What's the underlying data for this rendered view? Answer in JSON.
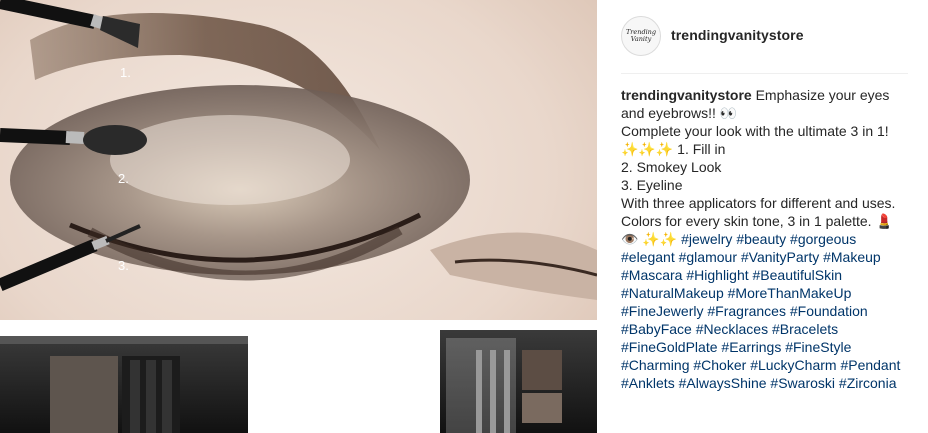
{
  "post": {
    "media": {
      "step_labels": [
        "1.",
        "2.",
        "3."
      ]
    },
    "header": {
      "avatar_text": [
        "Trending",
        "Vanity"
      ],
      "username": "trendingvanitystore"
    },
    "caption": {
      "author": "trendingvanitystore",
      "intro": "Emphasize your eyes and eyebrows!! 👀",
      "line2": "Complete your look with the ultimate 3 in 1!",
      "line3": "✨✨✨ 1. Fill in",
      "line4": "2. Smokey Look",
      "line5": "3. Eyeline",
      "line6": "With three applicators for different and uses. Colors for every skin tone, 3 in 1 palette. 💄 👁️ ✨✨",
      "hashtags": [
        "#jewelry",
        "#beauty",
        "#gorgeous",
        "#elegant",
        "#glamour",
        "#VanityParty",
        "#Makeup",
        "#Mascara",
        "#Highlight",
        "#BeautifulSkin",
        "#NaturalMakeup",
        "#MoreThanMakeUp",
        "#FineJewerly",
        "#Fragrances",
        "#Foundation",
        "#BabyFace",
        "#Necklaces",
        "#Bracelets",
        "#FineGoldPlate",
        "#Earrings",
        "#FineStyle",
        "#Charming",
        "#Choker",
        "#LuckyCharm",
        "#Pendant",
        "#Anklets",
        "#AlwaysShine",
        "#Swaroski",
        "#Zirconia"
      ]
    }
  }
}
